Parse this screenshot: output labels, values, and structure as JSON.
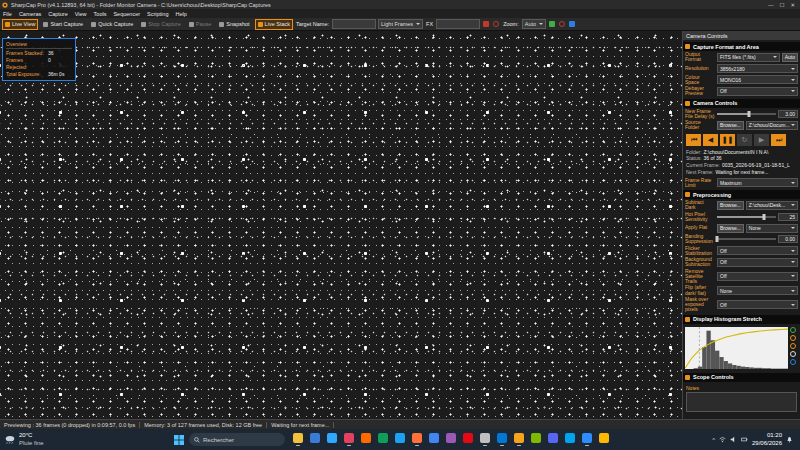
{
  "window": {
    "title": "SharpCap Pro (v4.1.12893, 64 bit) - Folder Monitor Camera - C:\\Users\\chouu\\Desktop\\SharpCap Captures",
    "controls": [
      "—",
      "☐",
      "✕"
    ]
  },
  "menu": [
    "File",
    "Cameras",
    "Capture",
    "View",
    "Tools",
    "Sequencer",
    "Scripting",
    "Help"
  ],
  "toolbar": {
    "buttons": [
      {
        "label": "Live View",
        "selected": true,
        "disabled": false
      },
      {
        "label": "Start Capture",
        "selected": false,
        "disabled": false
      },
      {
        "label": "Quick Capture",
        "selected": false,
        "disabled": false
      },
      {
        "label": "Stop Capture",
        "selected": false,
        "disabled": true
      },
      {
        "label": "Pause",
        "selected": false,
        "disabled": true
      },
      {
        "label": "Snapshot",
        "selected": false,
        "disabled": false
      },
      {
        "label": "Live Stack",
        "selected": true,
        "disabled": false
      }
    ],
    "target_label": "Target Name:",
    "frame_type": "Light Frames",
    "fx_label": "FX",
    "zoom_label": "Zoom:",
    "zoom_value": "Auto"
  },
  "overview": {
    "title": "Overview",
    "lines": [
      {
        "label": "Frames Stacked:",
        "value": "36"
      },
      {
        "label": "Frames Rejected:",
        "value": "0"
      },
      {
        "label": "Total Exposure:",
        "value": "36m 0s"
      }
    ]
  },
  "panel": {
    "title": "Camera Controls",
    "sections": [
      {
        "title": "Capture Format and Area",
        "rows": [
          {
            "kind": "select",
            "label": "Output Format",
            "value": "FITS files (*.fits)",
            "button": "Auto"
          },
          {
            "kind": "select",
            "label": "Resolution",
            "value": "3856x2180"
          },
          {
            "kind": "select",
            "label": "Colour Space",
            "value": "MONO16"
          },
          {
            "kind": "select",
            "label": "Debayer Preview",
            "value": "Off"
          }
        ]
      },
      {
        "title": "Camera Controls",
        "rows": [
          {
            "kind": "slider",
            "label": "New Frame File Delay (s)",
            "level": 0.55,
            "value": "3.00"
          },
          {
            "kind": "browse",
            "label": "Source Folder",
            "button": "Browse...",
            "value": "Z:\\chouu\\Docum..."
          },
          {
            "kind": "playback",
            "buttons": [
              {
                "icon": "⏮",
                "disabled": false
              },
              {
                "icon": "◀",
                "disabled": false
              },
              {
                "icon": "❚❚",
                "disabled": false
              },
              {
                "icon": "↻",
                "disabled": true
              },
              {
                "icon": "▶",
                "disabled": true
              },
              {
                "icon": "⏭",
                "disabled": false
              }
            ]
          },
          {
            "kind": "info",
            "lines": [
              {
                "label": "Folder:",
                "value": "Z:\\chouu\\Documents\\N I N A\\"
              },
              {
                "label": "Status:",
                "value": "36 of 36"
              },
              {
                "label": "Current Frame:",
                "value": "0035_2026-06-19_01-18-51_L"
              },
              {
                "label": "Next Frame:",
                "value": "Waiting for next frame..."
              }
            ]
          },
          {
            "kind": "select",
            "label": "Frame Rate Limit",
            "value": "Maximum"
          }
        ]
      },
      {
        "title": "Preprocessing",
        "rows": [
          {
            "kind": "browse",
            "label": "Subtract Dark",
            "button": "Browse...",
            "value": "Z:\\chouu\\Desk..."
          },
          {
            "kind": "slider",
            "label": "Hot Pixel Sensitivity",
            "level": 0.8,
            "value": "25"
          },
          {
            "kind": "browse",
            "label": "Apply Flat",
            "button": "Browse...",
            "value": "None"
          },
          {
            "kind": "slider",
            "label": "Banding Suppression",
            "level": 0.0,
            "value": "0.00"
          },
          {
            "kind": "select",
            "label": "Flicker Stabilization",
            "value": "Off"
          },
          {
            "kind": "select",
            "label": "Background Subtraction",
            "value": "Off"
          },
          {
            "kind": "select",
            "label": "Remove Satellite Trails",
            "value": "Off"
          },
          {
            "kind": "select",
            "label": "Flip (after dark/ flat)",
            "value": "None"
          },
          {
            "kind": "select",
            "label": "Mask over exposed pixels",
            "value": "Off"
          }
        ]
      },
      {
        "title": "Display Histogram Stretch",
        "rows": [
          {
            "kind": "histogram",
            "values": [
              0,
              0,
              2,
              6,
              55,
              96,
              72,
              46,
              30,
              20,
              14,
              10,
              8,
              6,
              5,
              4,
              3,
              3,
              2,
              2,
              1,
              1,
              1,
              1
            ],
            "curve": [
              2,
              28,
              46,
              58,
              67,
              74,
              80,
              84,
              88,
              91,
              93,
              95,
              97,
              98,
              99,
              100
            ],
            "tools": [
              {
                "color": "#3cb043"
              },
              {
                "color": "#e8901a"
              },
              {
                "color": "#e8901a"
              },
              {
                "color": "#dddddd"
              },
              {
                "color": "#2b7fe0"
              }
            ]
          }
        ]
      },
      {
        "title": "Scope Controls",
        "rows": [
          {
            "kind": "notes",
            "label": "Notes"
          }
        ]
      }
    ]
  },
  "status_bar": [
    "Previewing : 36 frames (0 dropped) in 0:09:57, 0.0 fps",
    "Memory: 3 of 127 frames used, Disk: 12 GB free",
    "Waiting for next frame..."
  ],
  "taskbar": {
    "weather": {
      "temp": "20°C",
      "desc": "Pluie fine"
    },
    "search": {
      "placeholder": "Rechercher"
    },
    "apps": [
      {
        "color": "#f2c23a",
        "running": true
      },
      {
        "color": "#3a7bd5",
        "running": false
      },
      {
        "color": "#31a8ff",
        "running": false
      },
      {
        "color": "#e4405f",
        "running": true
      },
      {
        "color": "#ff6a00",
        "running": false
      },
      {
        "color": "#0f9d58",
        "running": false
      },
      {
        "color": "#1da1f2",
        "running": false
      },
      {
        "color": "#ff7139",
        "running": true
      },
      {
        "color": "#4285f4",
        "running": false
      },
      {
        "color": "#9b59b6",
        "running": false
      },
      {
        "color": "#e50914",
        "running": false
      },
      {
        "color": "#c0c0c0",
        "running": true
      },
      {
        "color": "#0078d4",
        "running": true
      },
      {
        "color": "#f7a21b",
        "running": true
      },
      {
        "color": "#7fba00",
        "running": false
      },
      {
        "color": "#5865f2",
        "running": false
      },
      {
        "color": "#00a4ef",
        "running": false
      },
      {
        "color": "#2d8cff",
        "running": true
      },
      {
        "color": "#ffb900",
        "running": false
      }
    ],
    "tray_chevron": "^",
    "time": "01:20",
    "date": "29/06/2026"
  }
}
